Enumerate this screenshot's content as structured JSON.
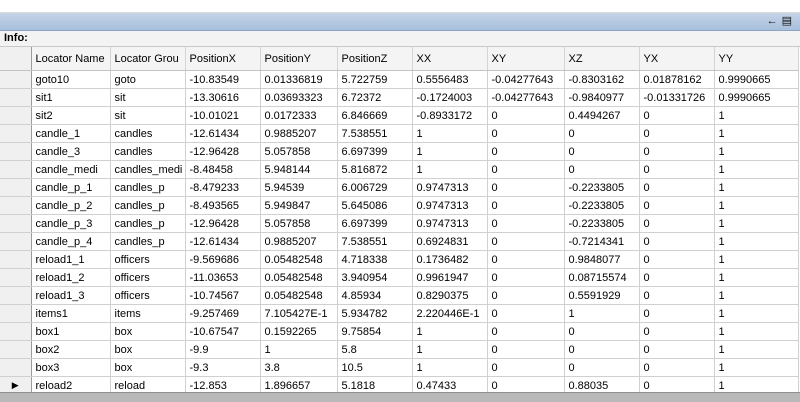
{
  "window": {
    "pin_icon": "pin-icon",
    "dock_icon": "dock-window-icon"
  },
  "info_label": "Info:",
  "table": {
    "columns": [
      "Locator Name",
      "Locator Grou",
      "PositionX",
      "PositionY",
      "PositionZ",
      "XX",
      "XY",
      "XZ",
      "YX",
      "YY"
    ],
    "rows": [
      [
        "goto10",
        "goto",
        "-10.83549",
        "0.01336819",
        "5.722759",
        "0.5556483",
        "-0.04277643",
        "-0.8303162",
        "0.01878162",
        "0.9990665"
      ],
      [
        "sit1",
        "sit",
        "-13.30616",
        "0.03693323",
        "6.72372",
        "-0.1724003",
        "-0.04277643",
        "-0.9840977",
        "-0.01331726",
        "0.9990665"
      ],
      [
        "sit2",
        "sit",
        "-10.01021",
        "0.0172333",
        "6.846669",
        "-0.8933172",
        "0",
        "0.4494267",
        "0",
        "1"
      ],
      [
        "candle_1",
        "candles",
        "-12.61434",
        "0.9885207",
        "7.538551",
        "1",
        "0",
        "0",
        "0",
        "1"
      ],
      [
        "candle_3",
        "candles",
        "-12.96428",
        "5.057858",
        "6.697399",
        "1",
        "0",
        "0",
        "0",
        "1"
      ],
      [
        "candle_medi",
        "candles_medi",
        "-8.48458",
        "5.948144",
        "5.816872",
        "1",
        "0",
        "0",
        "0",
        "1"
      ],
      [
        "candle_p_1",
        "candles_p",
        "-8.479233",
        "5.94539",
        "6.006729",
        "0.9747313",
        "0",
        "-0.2233805",
        "0",
        "1"
      ],
      [
        "candle_p_2",
        "candles_p",
        "-8.493565",
        "5.949847",
        "5.645086",
        "0.9747313",
        "0",
        "-0.2233805",
        "0",
        "1"
      ],
      [
        "candle_p_3",
        "candles_p",
        "-12.96428",
        "5.057858",
        "6.697399",
        "0.9747313",
        "0",
        "-0.2233805",
        "0",
        "1"
      ],
      [
        "candle_p_4",
        "candles_p",
        "-12.61434",
        "0.9885207",
        "7.538551",
        "0.6924831",
        "0",
        "-0.7214341",
        "0",
        "1"
      ],
      [
        "reload1_1",
        "officers",
        "-9.569686",
        "0.05482548",
        "4.718338",
        "0.1736482",
        "0",
        "0.9848077",
        "0",
        "1"
      ],
      [
        "reload1_2",
        "officers",
        "-11.03653",
        "0.05482548",
        "3.940954",
        "0.9961947",
        "0",
        "0.08715574",
        "0",
        "1"
      ],
      [
        "reload1_3",
        "officers",
        "-10.74567",
        "0.05482548",
        "4.85934",
        "0.8290375",
        "0",
        "0.5591929",
        "0",
        "1"
      ],
      [
        "items1",
        "items",
        "-9.257469",
        "7.105427E-1",
        "5.934782",
        "2.220446E-1",
        "0",
        "1",
        "0",
        "1"
      ],
      [
        "box1",
        "box",
        "-10.67547",
        "0.1592265",
        "9.75854",
        "1",
        "0",
        "0",
        "0",
        "1"
      ],
      [
        "box2",
        "box",
        "-9.9",
        "1",
        "5.8",
        "1",
        "0",
        "0",
        "0",
        "1"
      ],
      [
        "box3",
        "box",
        "-9.3",
        "3.8",
        "10.5",
        "1",
        "0",
        "0",
        "0",
        "1"
      ],
      [
        "reload2",
        "reload",
        "-12.853",
        "1.896657",
        "5.1818",
        "0.47433",
        "0",
        "0.88035",
        "0",
        "1"
      ]
    ],
    "current_row_marker": "▶",
    "new_row_marker": "✱"
  }
}
